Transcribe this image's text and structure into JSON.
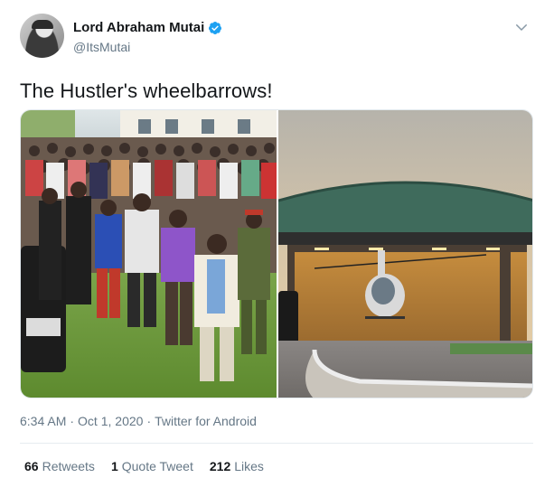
{
  "author": {
    "display_name": "Lord Abraham Mutai",
    "handle": "@ItsMutai",
    "verified": true,
    "avatar_icon": "profile-photo"
  },
  "menu_icon": "chevron-down-icon",
  "tweet": {
    "text": "The Hustler's wheelbarrows!"
  },
  "media": {
    "count": 2,
    "left_description_icon": "crowd-photo",
    "right_description_icon": "helicopter-hangar-photo"
  },
  "meta": {
    "time": "6:34 AM",
    "dot1": "·",
    "date": "Oct 1, 2020",
    "dot2": "·",
    "source": "Twitter for Android"
  },
  "stats": {
    "retweets_count": "66",
    "retweets_label": "Retweets",
    "quotes_count": "1",
    "quotes_label": "Quote Tweet",
    "likes_count": "212",
    "likes_label": "Likes"
  },
  "colors": {
    "verified_blue": "#1da1f2",
    "secondary_text": "#657786",
    "primary_text": "#14171a"
  }
}
